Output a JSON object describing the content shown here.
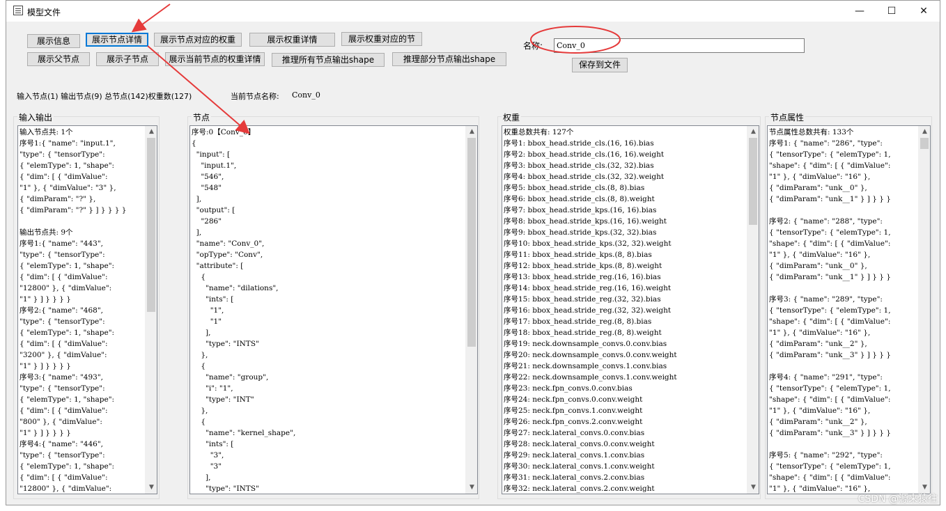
{
  "window": {
    "title": "模型文件",
    "minimize_icon": "minimize-icon",
    "maximize_icon": "maximize-icon",
    "close_icon": "close-icon",
    "minimize_glyph": "—",
    "maximize_glyph": "☐",
    "close_glyph": "✕"
  },
  "toolbar": {
    "row1": [
      "展示信息",
      "展示节点详情",
      "展示节点对应的权重",
      "展示权重详情",
      "展示权重对应的节"
    ],
    "row2": [
      "展示父节点",
      "展示子节点",
      "展示当前节点的权重详情",
      "推理所有节点输出shape",
      "推理部分节点输出shape"
    ]
  },
  "name_field": {
    "label": "名称:",
    "value": "Conv_0"
  },
  "save_button": "保存到文件",
  "status": {
    "summary": "输入节点(1) 输出节点(9) 总节点(142)权重数(127)",
    "current_label": "当前节点名称:",
    "current_value": "Conv_0"
  },
  "panels": {
    "io": {
      "title": "输入输出",
      "lines": [
        "输入节点共: 1个",
        "序号1:{ \"name\": \"input.1\",",
        "\"type\": { \"tensorType\":",
        "{ \"elemType\": 1, \"shape\":",
        "{ \"dim\": [ { \"dimValue\":",
        "\"1\" }, { \"dimValue\": \"3\" },",
        "{ \"dimParam\": \"?\" },",
        "{ \"dimParam\": \"?\" } ] } } } }",
        "",
        "输出节点共: 9个",
        "序号1:{ \"name\": \"443\",",
        "\"type\": { \"tensorType\":",
        "{ \"elemType\": 1, \"shape\":",
        "{ \"dim\": [ { \"dimValue\":",
        "\"12800\" }, { \"dimValue\":",
        "\"1\" } ] } } } }",
        "序号2:{ \"name\": \"468\",",
        "\"type\": { \"tensorType\":",
        "{ \"elemType\": 1, \"shape\":",
        "{ \"dim\": [ { \"dimValue\":",
        "\"3200\" }, { \"dimValue\":",
        "\"1\" } ] } } } }",
        "序号3:{ \"name\": \"493\",",
        "\"type\": { \"tensorType\":",
        "{ \"elemType\": 1, \"shape\":",
        "{ \"dim\": [ { \"dimValue\":",
        "\"800\" }, { \"dimValue\":",
        "\"1\" } ] } } } }",
        "序号4:{ \"name\": \"446\",",
        "\"type\": { \"tensorType\":",
        "{ \"elemType\": 1, \"shape\":",
        "{ \"dim\": [ { \"dimValue\":",
        "\"12800\" }, { \"dimValue\":"
      ]
    },
    "node": {
      "title": "节点",
      "lines": [
        "序号:0【Conv_0】",
        "{",
        "  \"input\": [",
        "    \"input.1\",",
        "    \"546\",",
        "    \"548\"",
        "  ],",
        "  \"output\": [",
        "    \"286\"",
        "  ],",
        "  \"name\": \"Conv_0\",",
        "  \"opType\": \"Conv\",",
        "  \"attribute\": [",
        "    {",
        "      \"name\": \"dilations\",",
        "      \"ints\": [",
        "        \"1\",",
        "        \"1\"",
        "      ],",
        "      \"type\": \"INTS\"",
        "    },",
        "    {",
        "      \"name\": \"group\",",
        "      \"i\": \"1\",",
        "      \"type\": \"INT\"",
        "    },",
        "    {",
        "      \"name\": \"kernel_shape\",",
        "      \"ints\": [",
        "        \"3\",",
        "        \"3\"",
        "      ],",
        "      \"type\": \"INTS\""
      ]
    },
    "weights": {
      "title": "权重",
      "lines": [
        "权重总数共有: 127个",
        "序号1: bbox_head.stride_cls.(16, 16).bias",
        "序号2: bbox_head.stride_cls.(16, 16).weight",
        "序号3: bbox_head.stride_cls.(32, 32).bias",
        "序号4: bbox_head.stride_cls.(32, 32).weight",
        "序号5: bbox_head.stride_cls.(8, 8).bias",
        "序号6: bbox_head.stride_cls.(8, 8).weight",
        "序号7: bbox_head.stride_kps.(16, 16).bias",
        "序号8: bbox_head.stride_kps.(16, 16).weight",
        "序号9: bbox_head.stride_kps.(32, 32).bias",
        "序号10: bbox_head.stride_kps.(32, 32).weight",
        "序号11: bbox_head.stride_kps.(8, 8).bias",
        "序号12: bbox_head.stride_kps.(8, 8).weight",
        "序号13: bbox_head.stride_reg.(16, 16).bias",
        "序号14: bbox_head.stride_reg.(16, 16).weight",
        "序号15: bbox_head.stride_reg.(32, 32).bias",
        "序号16: bbox_head.stride_reg.(32, 32).weight",
        "序号17: bbox_head.stride_reg.(8, 8).bias",
        "序号18: bbox_head.stride_reg.(8, 8).weight",
        "序号19: neck.downsample_convs.0.conv.bias",
        "序号20: neck.downsample_convs.0.conv.weight",
        "序号21: neck.downsample_convs.1.conv.bias",
        "序号22: neck.downsample_convs.1.conv.weight",
        "序号23: neck.fpn_convs.0.conv.bias",
        "序号24: neck.fpn_convs.0.conv.weight",
        "序号25: neck.fpn_convs.1.conv.weight",
        "序号26: neck.fpn_convs.2.conv.weight",
        "序号27: neck.lateral_convs.0.conv.bias",
        "序号28: neck.lateral_convs.0.conv.weight",
        "序号29: neck.lateral_convs.1.conv.bias",
        "序号30: neck.lateral_convs.1.conv.weight",
        "序号31: neck.lateral_convs.2.conv.bias",
        "序号32: neck.lateral_convs.2.conv.weight"
      ]
    },
    "attrs": {
      "title": "节点属性",
      "lines": [
        "节点属性总数共有: 133个",
        "序号1: { \"name\": \"286\", \"type\":",
        "{ \"tensorType\": { \"elemType\": 1,",
        "\"shape\": { \"dim\": [ { \"dimValue\":",
        "\"1\" }, { \"dimValue\": \"16\" },",
        "{ \"dimParam\": \"unk__0\" },",
        "{ \"dimParam\": \"unk__1\" } ] } } }",
        "",
        "序号2: { \"name\": \"288\", \"type\":",
        "{ \"tensorType\": { \"elemType\": 1,",
        "\"shape\": { \"dim\": [ { \"dimValue\":",
        "\"1\" }, { \"dimValue\": \"16\" },",
        "{ \"dimParam\": \"unk__0\" },",
        "{ \"dimParam\": \"unk__1\" } ] } } }",
        "",
        "序号3: { \"name\": \"289\", \"type\":",
        "{ \"tensorType\": { \"elemType\": 1,",
        "\"shape\": { \"dim\": [ { \"dimValue\":",
        "\"1\" }, { \"dimValue\": \"16\" },",
        "{ \"dimParam\": \"unk__2\" },",
        "{ \"dimParam\": \"unk__3\" } ] } } }",
        "",
        "序号4: { \"name\": \"291\", \"type\":",
        "{ \"tensorType\": { \"elemType\": 1,",
        "\"shape\": { \"dim\": [ { \"dimValue\":",
        "\"1\" }, { \"dimValue\": \"16\" },",
        "{ \"dimParam\": \"unk__2\" },",
        "{ \"dimParam\": \"unk__3\" } ] } } }",
        "",
        "序号5: { \"name\": \"292\", \"type\":",
        "{ \"tensorType\": { \"elemType\": 1,",
        "\"shape\": { \"dim\": [ { \"dimValue\":",
        "\"1\" }, { \"dimValue\": \"16\" },"
      ]
    }
  },
  "scroll": {
    "up_glyph": "▲",
    "down_glyph": "▼"
  },
  "watermark": "CSDN @源来猿往",
  "annotation_color": "#e53a3a",
  "accent_color": "#0078d7"
}
